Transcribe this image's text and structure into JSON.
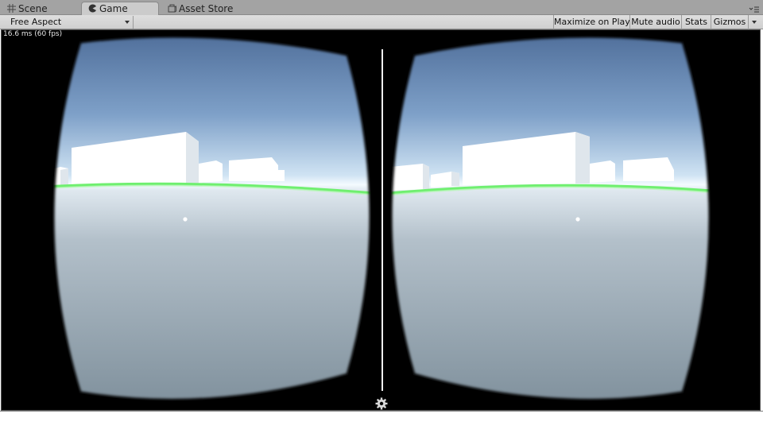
{
  "tabs": [
    {
      "label": "Scene",
      "icon": "grid-icon",
      "active": false
    },
    {
      "label": "Game",
      "icon": "pacman-icon",
      "active": true
    },
    {
      "label": "Asset Store",
      "icon": "store-bag-icon",
      "active": false
    }
  ],
  "toolbar": {
    "aspect": "Free Aspect",
    "maximize_on_play": "Maximize on Play",
    "mute_audio": "Mute audio",
    "stats": "Stats",
    "gizmos": "Gizmos"
  },
  "game": {
    "fps": "16.6 ms (60 fps)",
    "settings_icon": "gear-icon",
    "colors": {
      "sky_top": "#5a78a3",
      "horizon": "#eef6fb",
      "ground": "#8a9aa6",
      "horizon_line": "#6fef6f"
    }
  }
}
